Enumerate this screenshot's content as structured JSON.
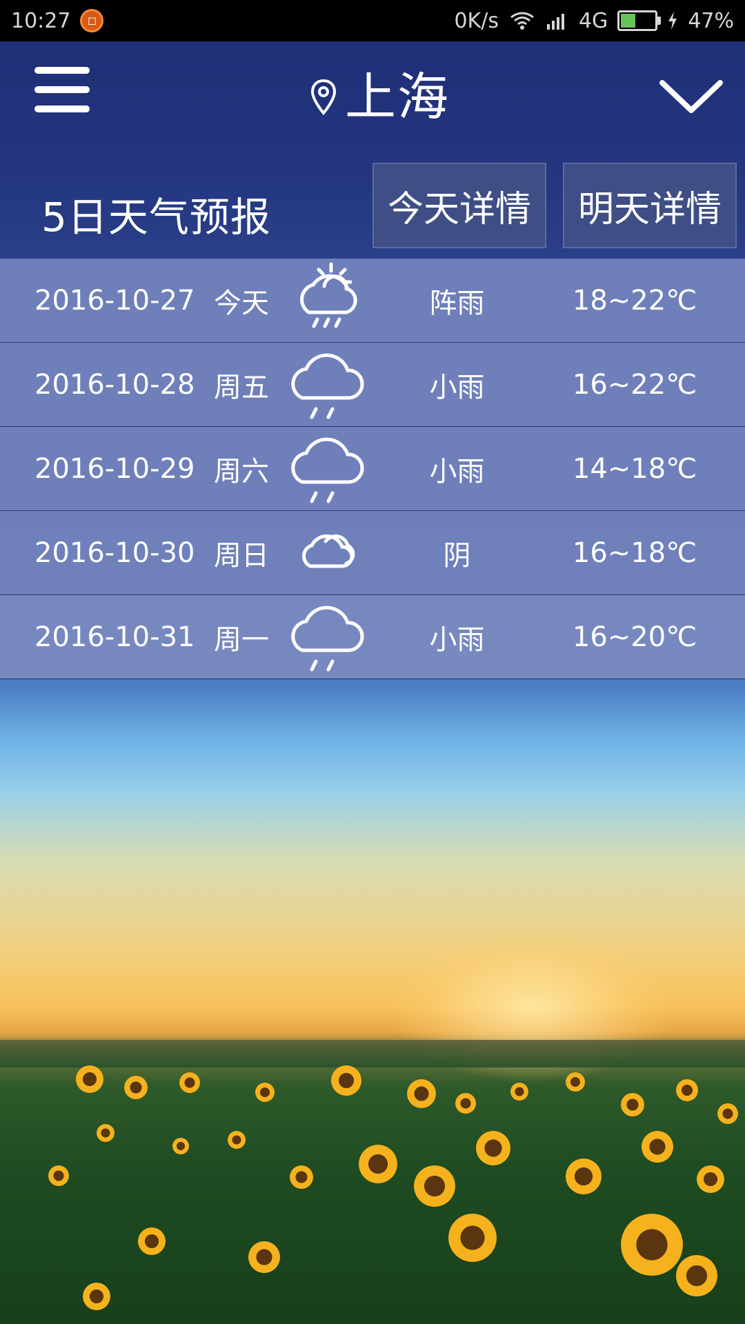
{
  "status_bar": {
    "time": "10:27",
    "notif_symbol": "◻",
    "net_speed": "0K/s",
    "network": "4G",
    "battery": "47%",
    "battery_level": 0.47,
    "icons": [
      "wifi-icon",
      "signal-icon",
      "battery-icon",
      "charging-icon"
    ]
  },
  "header": {
    "city": "上海",
    "menu_icon": "menu-icon",
    "location_icon": "location-pin-icon",
    "dropdown_icon": "chevron-down-icon"
  },
  "subheader": {
    "title": "5日天气预报",
    "today_button": "今天详情",
    "tomorrow_button": "明天详情"
  },
  "forecast": [
    {
      "date": "2016-10-27",
      "day": "今天",
      "icon": "partly-sunny-rain-icon",
      "desc": "阵雨",
      "temp": "18~22℃"
    },
    {
      "date": "2016-10-28",
      "day": "周五",
      "icon": "rain-cloud-icon",
      "desc": "小雨",
      "temp": "16~22℃"
    },
    {
      "date": "2016-10-29",
      "day": "周六",
      "icon": "rain-cloud-icon",
      "desc": "小雨",
      "temp": "14~18℃"
    },
    {
      "date": "2016-10-30",
      "day": "周日",
      "icon": "cloudy-icon",
      "desc": "阴",
      "temp": "16~18℃"
    },
    {
      "date": "2016-10-31",
      "day": "周一",
      "icon": "rain-cloud-icon",
      "desc": "小雨",
      "temp": "16~20℃"
    }
  ],
  "colors": {
    "header_bg": "#1f2f78",
    "row_bg": "#7483bc",
    "button_bg": "#3f4e84",
    "status_bar_bg": "#000000"
  }
}
